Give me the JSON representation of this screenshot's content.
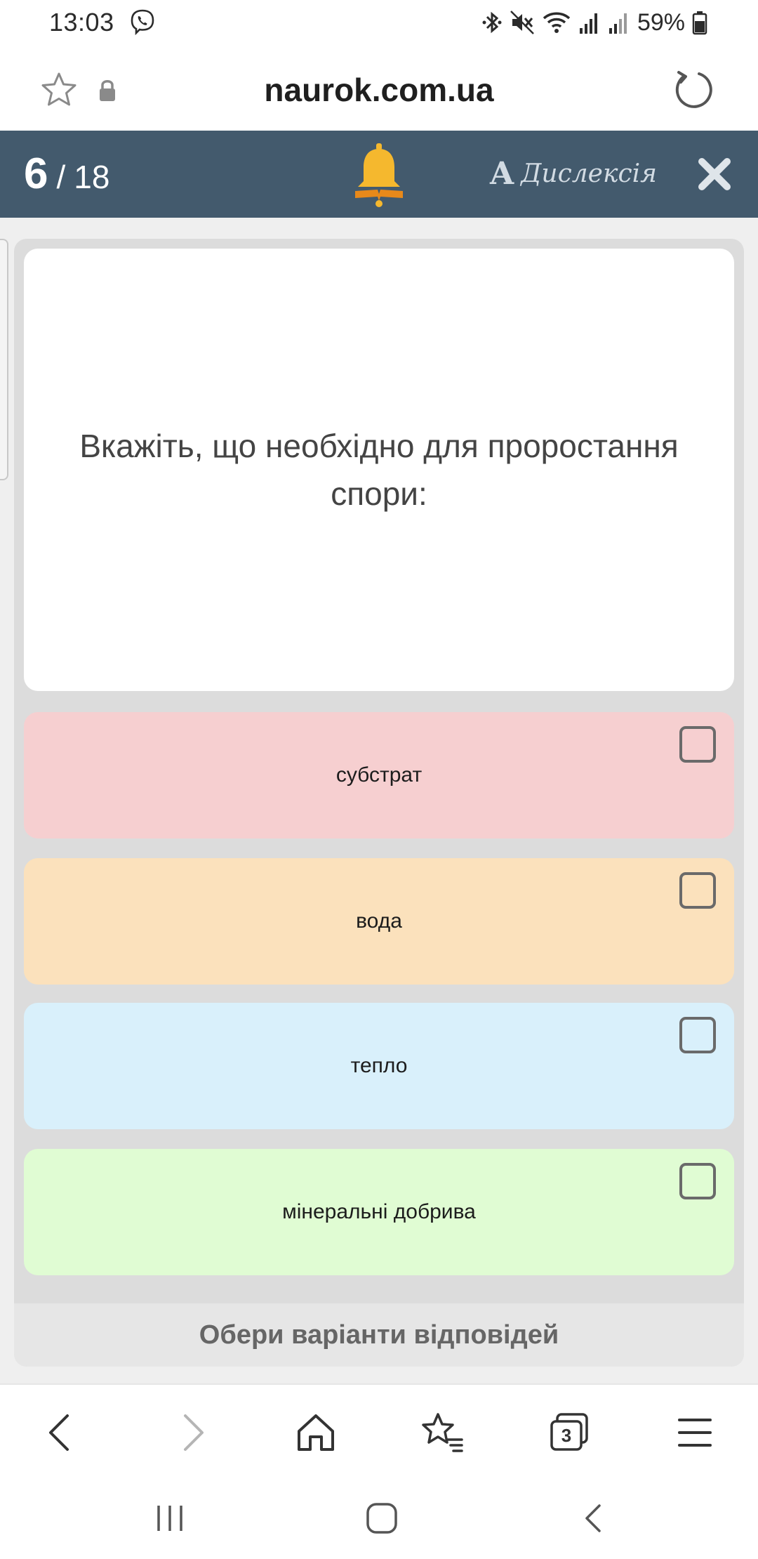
{
  "status_bar": {
    "time": "13:03",
    "battery": "59%",
    "icons": [
      "viber-icon",
      "bluetooth-icon",
      "mute-icon",
      "wifi-icon",
      "signal-icon",
      "signal-icon-2",
      "battery-icon"
    ]
  },
  "browser": {
    "url": "naurok.com.ua",
    "tab_count": "3",
    "icons": [
      "bookmark-star-icon",
      "lock-icon",
      "reload-icon"
    ]
  },
  "quiz_header": {
    "current": "6",
    "separator": "/",
    "total": "18",
    "dyslexia_letter": "A",
    "dyslexia_label": "Дислексія"
  },
  "question": {
    "text": "Вкажіть, що необхідно для проростання спори:"
  },
  "answers": [
    {
      "label": "субстрат",
      "color": "#f6cfd0",
      "checked": false
    },
    {
      "label": "вода",
      "color": "#fbe1bc",
      "checked": false
    },
    {
      "label": "тепло",
      "color": "#d9f0fb",
      "checked": false
    },
    {
      "label": "мінеральні добрива",
      "color": "#e0fcd3",
      "checked": false
    }
  ],
  "footer": {
    "hint": "Обери варіанти відповідей"
  },
  "colors": {
    "header_bg": "#435a6d",
    "bell": "#f5b82e",
    "panel_bg": "#dcdcdc"
  }
}
